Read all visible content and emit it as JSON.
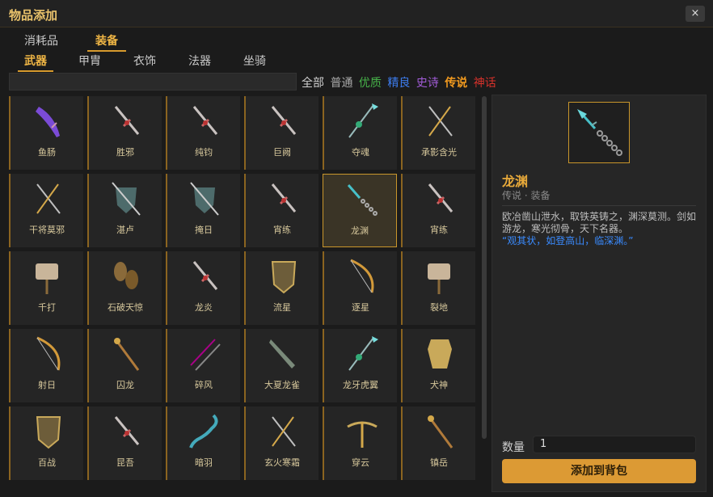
{
  "window": {
    "title": "物品添加",
    "close": "×"
  },
  "tabs_primary": [
    {
      "label": "消耗品",
      "active": false
    },
    {
      "label": "装备",
      "active": true
    }
  ],
  "tabs_secondary": [
    {
      "label": "武器",
      "active": true
    },
    {
      "label": "甲胄",
      "active": false
    },
    {
      "label": "衣饰",
      "active": false
    },
    {
      "label": "法器",
      "active": false
    },
    {
      "label": "坐骑",
      "active": false
    }
  ],
  "search": {
    "value": ""
  },
  "rarity_filters": [
    {
      "label": "全部",
      "color": "#cfcfcf"
    },
    {
      "label": "普通",
      "color": "#a9a9a9"
    },
    {
      "label": "优质",
      "color": "#47b34a"
    },
    {
      "label": "精良",
      "color": "#3d7df0"
    },
    {
      "label": "史诗",
      "color": "#a25cd8"
    },
    {
      "label": "传说",
      "color": "#f39b1f"
    },
    {
      "label": "神话",
      "color": "#d8322b"
    }
  ],
  "items": [
    {
      "label": "鱼肠",
      "icon": "dagger-icon"
    },
    {
      "label": "胜邪",
      "icon": "sword-icon"
    },
    {
      "label": "纯钧",
      "icon": "sword-icon"
    },
    {
      "label": "巨阙",
      "icon": "sword-icon"
    },
    {
      "label": "夺魂",
      "icon": "spear-icon"
    },
    {
      "label": "承影含光",
      "icon": "twin-swords-icon"
    },
    {
      "label": "干将莫邪",
      "icon": "twin-swords-icon"
    },
    {
      "label": "湛卢",
      "icon": "shield-sword-icon"
    },
    {
      "label": "掩日",
      "icon": "shield-sword-icon"
    },
    {
      "label": "宵练",
      "icon": "sword-icon"
    },
    {
      "label": "龙渊",
      "icon": "chain-spear-icon",
      "selected": true
    },
    {
      "label": "宵练",
      "icon": "sword-icon"
    },
    {
      "label": "千打",
      "icon": "hammer-icon"
    },
    {
      "label": "石破天惊",
      "icon": "mace-icon"
    },
    {
      "label": "龙炎",
      "icon": "sword-icon"
    },
    {
      "label": "流星",
      "icon": "shield-icon"
    },
    {
      "label": "逐星",
      "icon": "bow-icon"
    },
    {
      "label": "裂地",
      "icon": "hammer-icon"
    },
    {
      "label": "射日",
      "icon": "bow-icon"
    },
    {
      "label": "囚龙",
      "icon": "staff-icon"
    },
    {
      "label": "碎风",
      "icon": "twin-axes-icon"
    },
    {
      "label": "大夏龙雀",
      "icon": "blade-icon"
    },
    {
      "label": "龙牙虎翼",
      "icon": "spear-icon"
    },
    {
      "label": "犬神",
      "icon": "armor-icon"
    },
    {
      "label": "百战",
      "icon": "shield-icon"
    },
    {
      "label": "昆吾",
      "icon": "sword-icon"
    },
    {
      "label": "暗羽",
      "icon": "glaive-icon"
    },
    {
      "label": "玄火寒霜",
      "icon": "twin-swords-icon"
    },
    {
      "label": "穿云",
      "icon": "crossbow-icon"
    },
    {
      "label": "镇岳",
      "icon": "staff-icon"
    }
  ],
  "detail": {
    "name": "龙渊",
    "subtitle": "传说 · 装备",
    "description": "欧冶凿山泄水，取铁英铸之，渊深莫测。剑如游龙，寒光彻骨，天下名器。",
    "quote": "“观其状，如登高山，临深渊。”",
    "quantity_label": "数量",
    "quantity": "1",
    "add_button": "添加到背包"
  },
  "colors": {
    "accent": "#d79a2d",
    "legend": "#f39b1f"
  }
}
